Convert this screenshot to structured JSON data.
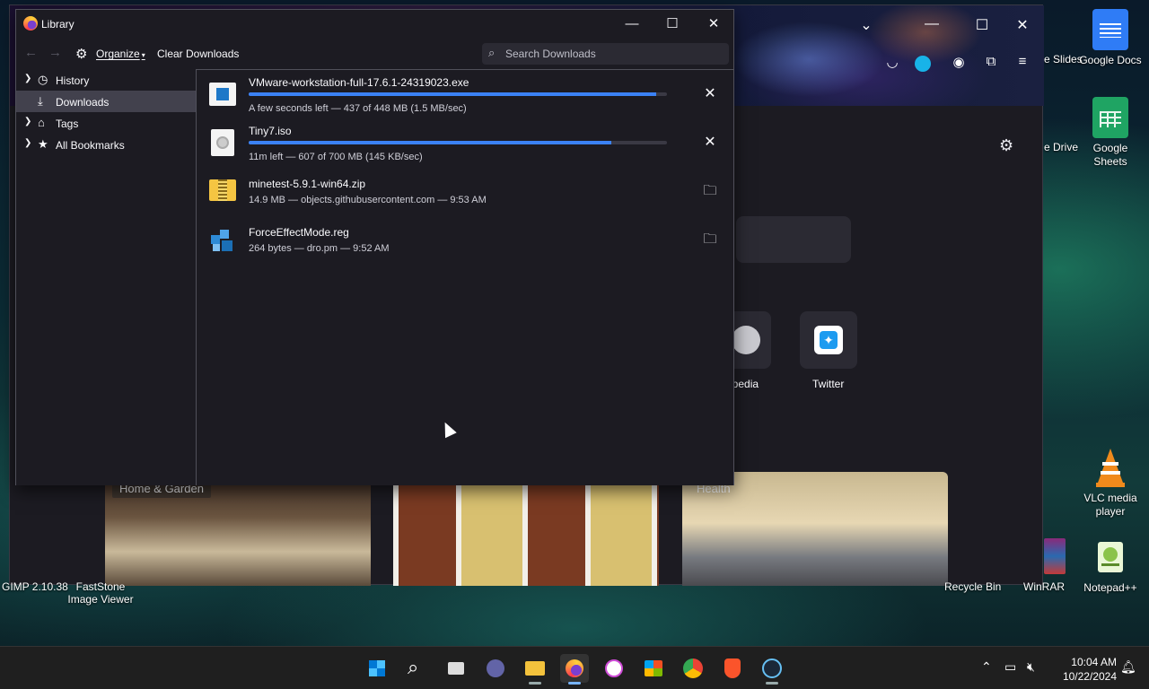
{
  "desktop": {
    "icons": {
      "slides_partial": "e Slides",
      "docs": "Google Docs",
      "drive_partial": "e Drive",
      "sheets_line1": "Google",
      "sheets_line2": "Sheets",
      "vlc_line1": "VLC media",
      "vlc_line2": "player",
      "notepad": "Notepad++"
    },
    "bottom_labels": {
      "gimp": "GIMP 2.10.38",
      "faststone_line1": "FastStone",
      "faststone_line2": "Image Viewer",
      "recycle": "Recycle Bin",
      "winrar": "WinRAR"
    }
  },
  "firefox": {
    "tiles": {
      "wikipedia_partial": "ipedia",
      "twitter": "Twitter"
    },
    "stories": {
      "home_garden": "Home & Garden",
      "health": "Health"
    }
  },
  "library": {
    "title": "Library",
    "toolbar": {
      "organize": "Organize",
      "clear": "Clear Downloads",
      "search_placeholder": "Search Downloads"
    },
    "sidebar": [
      {
        "label": "History",
        "icon": "clock-icon",
        "expandable": true,
        "selected": false
      },
      {
        "label": "Downloads",
        "icon": "download-icon",
        "expandable": false,
        "selected": true
      },
      {
        "label": "Tags",
        "icon": "tag-icon",
        "expandable": true,
        "selected": false
      },
      {
        "label": "All Bookmarks",
        "icon": "star-icon",
        "expandable": true,
        "selected": false
      }
    ],
    "downloads": [
      {
        "name": "VMware-workstation-full-17.6.1-24319023.exe",
        "status": "A few seconds left — 437 of 448 MB (1.5 MB/sec)",
        "progress": 0.975,
        "action": "cancel",
        "icon": "installer-icon"
      },
      {
        "name": "Tiny7.iso",
        "status": "11m left — 607 of 700 MB (145 KB/sec)",
        "progress": 0.867,
        "action": "cancel",
        "icon": "disc-image-icon"
      },
      {
        "name": "minetest-5.9.1-win64.zip",
        "status": "14.9 MB — objects.githubusercontent.com — 9:53 AM",
        "progress": null,
        "action": "open-folder",
        "icon": "zip-folder-icon"
      },
      {
        "name": "ForceEffectMode.reg",
        "status": "264 bytes — dro.pm — 9:52 AM",
        "progress": null,
        "action": "open-folder",
        "icon": "registry-file-icon"
      }
    ]
  },
  "taskbar": {
    "apps": [
      "start",
      "search",
      "task-view",
      "teams-chat",
      "file-explorer",
      "firefox",
      "itunes",
      "ms-store",
      "chrome",
      "brave",
      "steam"
    ],
    "active_app": "firefox",
    "clock_time": "10:04 AM",
    "clock_date": "10/22/2024"
  },
  "colors": {
    "accent": "#3b82f6",
    "window_bg": "#1c1b22",
    "selected": "#42414d"
  }
}
